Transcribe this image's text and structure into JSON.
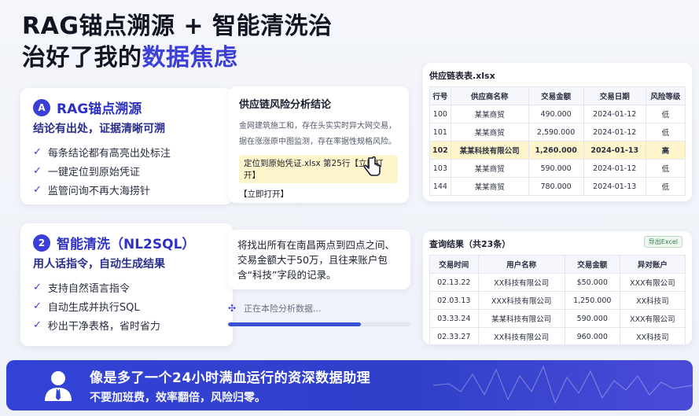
{
  "title": {
    "line1": "RAG锚点溯源 + 智能清洗治",
    "line2_plain": "治好了我的",
    "line2_highlight": "数据焦虑"
  },
  "feature_rag": {
    "icon_label": "A",
    "title": "RAG锚点溯源",
    "subtitle": "结论有出处，证据清晰可溯",
    "items": [
      "每条结论都有高亮出处标注",
      "一键定位到原始凭证",
      "监管问询不再大海捞针"
    ]
  },
  "conclusion": {
    "title": "供应链风险分析结论",
    "lines": [
      "金网建筑施工和，存在头实实时异大网交易，",
      "据在涨涨原中图监测，存在率据性规格风险。"
    ],
    "locate_text": "定位到原始凭证.xlsx 第25行【立即打开】",
    "open_link": "【立即打开】"
  },
  "supply_table": {
    "title": "供应链表表.xlsx",
    "headers": [
      "行号",
      "供应商名称",
      "交易金额",
      "交易日期",
      "风险等级"
    ],
    "rows": [
      [
        "100",
        "某某商贸",
        "490.000",
        "2024-01-12",
        "低"
      ],
      [
        "101",
        "某某商贸",
        "2,590.000",
        "2024-01-12",
        "低"
      ],
      [
        "102",
        "某某科技有限公司",
        "1,260.000",
        "2024-01-13",
        "高"
      ],
      [
        "103",
        "某某商贸",
        "590.000",
        "2024-01-12",
        "低"
      ],
      [
        "144",
        "某某商贸",
        "780.000",
        "2024-01-13",
        "低"
      ]
    ],
    "highlight_row": 2
  },
  "feature_nl2sql": {
    "icon_label": "2",
    "title": "智能清洗（NL2SQL）",
    "subtitle": "用人话指令，自动生成结果",
    "items": [
      "支持自然语言指令",
      "自动生成并执行SQL",
      "秒出干净表格，省时省力"
    ]
  },
  "prompt": {
    "text": "将找出所有在南昌两点到四点之间、交易金额大于50万，且往来账户包含“科技”字段的记录。"
  },
  "progress": {
    "label": "正在本险分析数据...",
    "percent": 73
  },
  "query_table": {
    "title": "查询结果（共23条）",
    "badge": "导出Excel",
    "headers": [
      "交易时间",
      "用户名称",
      "交易金额",
      "异对账户"
    ],
    "rows": [
      [
        "02.13.22",
        "XX科技有限公司",
        "$50.000",
        "XXX有限公司"
      ],
      [
        "02.03.13",
        "XXX科技有限公司",
        "1,250.000",
        "XX科技司"
      ],
      [
        "03.33.24",
        "某某科技有限公司",
        "590.000",
        "XXX有限公司"
      ],
      [
        "02.33.27",
        "XX科技有限公司",
        "960.000",
        "XX科技司"
      ]
    ]
  },
  "banner": {
    "line1": "像是多了一个24小时满血运行的资深数据助理",
    "line2": "不要加班费，效率翻倍，风险归零。"
  },
  "colors": {
    "accent": "#3b3fd8",
    "banner": "#3242d6",
    "highlight": "#fff5cc"
  }
}
